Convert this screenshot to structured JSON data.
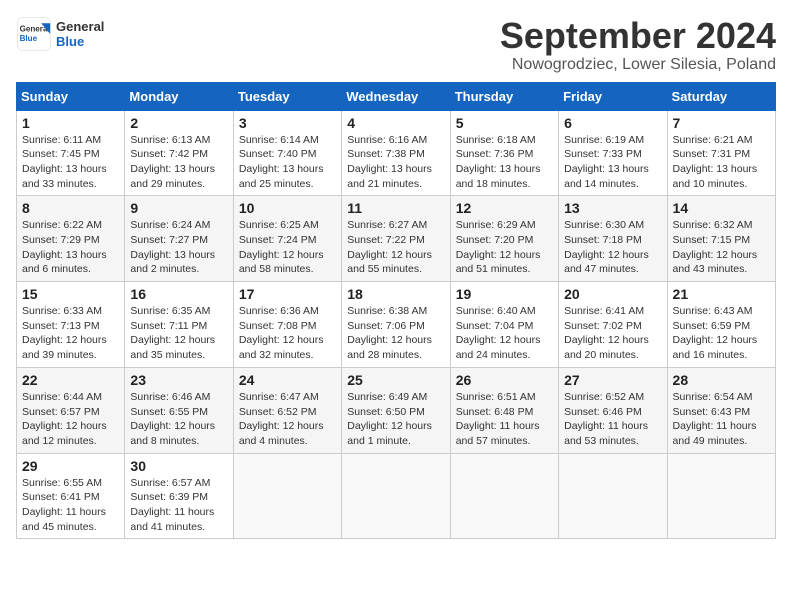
{
  "header": {
    "logo_general": "General",
    "logo_blue": "Blue",
    "month_title": "September 2024",
    "location": "Nowogrodziec, Lower Silesia, Poland"
  },
  "weekdays": [
    "Sunday",
    "Monday",
    "Tuesday",
    "Wednesday",
    "Thursday",
    "Friday",
    "Saturday"
  ],
  "weeks": [
    [
      {
        "day": "1",
        "info": "Sunrise: 6:11 AM\nSunset: 7:45 PM\nDaylight: 13 hours\nand 33 minutes."
      },
      {
        "day": "2",
        "info": "Sunrise: 6:13 AM\nSunset: 7:42 PM\nDaylight: 13 hours\nand 29 minutes."
      },
      {
        "day": "3",
        "info": "Sunrise: 6:14 AM\nSunset: 7:40 PM\nDaylight: 13 hours\nand 25 minutes."
      },
      {
        "day": "4",
        "info": "Sunrise: 6:16 AM\nSunset: 7:38 PM\nDaylight: 13 hours\nand 21 minutes."
      },
      {
        "day": "5",
        "info": "Sunrise: 6:18 AM\nSunset: 7:36 PM\nDaylight: 13 hours\nand 18 minutes."
      },
      {
        "day": "6",
        "info": "Sunrise: 6:19 AM\nSunset: 7:33 PM\nDaylight: 13 hours\nand 14 minutes."
      },
      {
        "day": "7",
        "info": "Sunrise: 6:21 AM\nSunset: 7:31 PM\nDaylight: 13 hours\nand 10 minutes."
      }
    ],
    [
      {
        "day": "8",
        "info": "Sunrise: 6:22 AM\nSunset: 7:29 PM\nDaylight: 13 hours\nand 6 minutes."
      },
      {
        "day": "9",
        "info": "Sunrise: 6:24 AM\nSunset: 7:27 PM\nDaylight: 13 hours\nand 2 minutes."
      },
      {
        "day": "10",
        "info": "Sunrise: 6:25 AM\nSunset: 7:24 PM\nDaylight: 12 hours\nand 58 minutes."
      },
      {
        "day": "11",
        "info": "Sunrise: 6:27 AM\nSunset: 7:22 PM\nDaylight: 12 hours\nand 55 minutes."
      },
      {
        "day": "12",
        "info": "Sunrise: 6:29 AM\nSunset: 7:20 PM\nDaylight: 12 hours\nand 51 minutes."
      },
      {
        "day": "13",
        "info": "Sunrise: 6:30 AM\nSunset: 7:18 PM\nDaylight: 12 hours\nand 47 minutes."
      },
      {
        "day": "14",
        "info": "Sunrise: 6:32 AM\nSunset: 7:15 PM\nDaylight: 12 hours\nand 43 minutes."
      }
    ],
    [
      {
        "day": "15",
        "info": "Sunrise: 6:33 AM\nSunset: 7:13 PM\nDaylight: 12 hours\nand 39 minutes."
      },
      {
        "day": "16",
        "info": "Sunrise: 6:35 AM\nSunset: 7:11 PM\nDaylight: 12 hours\nand 35 minutes."
      },
      {
        "day": "17",
        "info": "Sunrise: 6:36 AM\nSunset: 7:08 PM\nDaylight: 12 hours\nand 32 minutes."
      },
      {
        "day": "18",
        "info": "Sunrise: 6:38 AM\nSunset: 7:06 PM\nDaylight: 12 hours\nand 28 minutes."
      },
      {
        "day": "19",
        "info": "Sunrise: 6:40 AM\nSunset: 7:04 PM\nDaylight: 12 hours\nand 24 minutes."
      },
      {
        "day": "20",
        "info": "Sunrise: 6:41 AM\nSunset: 7:02 PM\nDaylight: 12 hours\nand 20 minutes."
      },
      {
        "day": "21",
        "info": "Sunrise: 6:43 AM\nSunset: 6:59 PM\nDaylight: 12 hours\nand 16 minutes."
      }
    ],
    [
      {
        "day": "22",
        "info": "Sunrise: 6:44 AM\nSunset: 6:57 PM\nDaylight: 12 hours\nand 12 minutes."
      },
      {
        "day": "23",
        "info": "Sunrise: 6:46 AM\nSunset: 6:55 PM\nDaylight: 12 hours\nand 8 minutes."
      },
      {
        "day": "24",
        "info": "Sunrise: 6:47 AM\nSunset: 6:52 PM\nDaylight: 12 hours\nand 4 minutes."
      },
      {
        "day": "25",
        "info": "Sunrise: 6:49 AM\nSunset: 6:50 PM\nDaylight: 12 hours\nand 1 minute."
      },
      {
        "day": "26",
        "info": "Sunrise: 6:51 AM\nSunset: 6:48 PM\nDaylight: 11 hours\nand 57 minutes."
      },
      {
        "day": "27",
        "info": "Sunrise: 6:52 AM\nSunset: 6:46 PM\nDaylight: 11 hours\nand 53 minutes."
      },
      {
        "day": "28",
        "info": "Sunrise: 6:54 AM\nSunset: 6:43 PM\nDaylight: 11 hours\nand 49 minutes."
      }
    ],
    [
      {
        "day": "29",
        "info": "Sunrise: 6:55 AM\nSunset: 6:41 PM\nDaylight: 11 hours\nand 45 minutes."
      },
      {
        "day": "30",
        "info": "Sunrise: 6:57 AM\nSunset: 6:39 PM\nDaylight: 11 hours\nand 41 minutes."
      },
      {
        "day": "",
        "info": ""
      },
      {
        "day": "",
        "info": ""
      },
      {
        "day": "",
        "info": ""
      },
      {
        "day": "",
        "info": ""
      },
      {
        "day": "",
        "info": ""
      }
    ]
  ]
}
